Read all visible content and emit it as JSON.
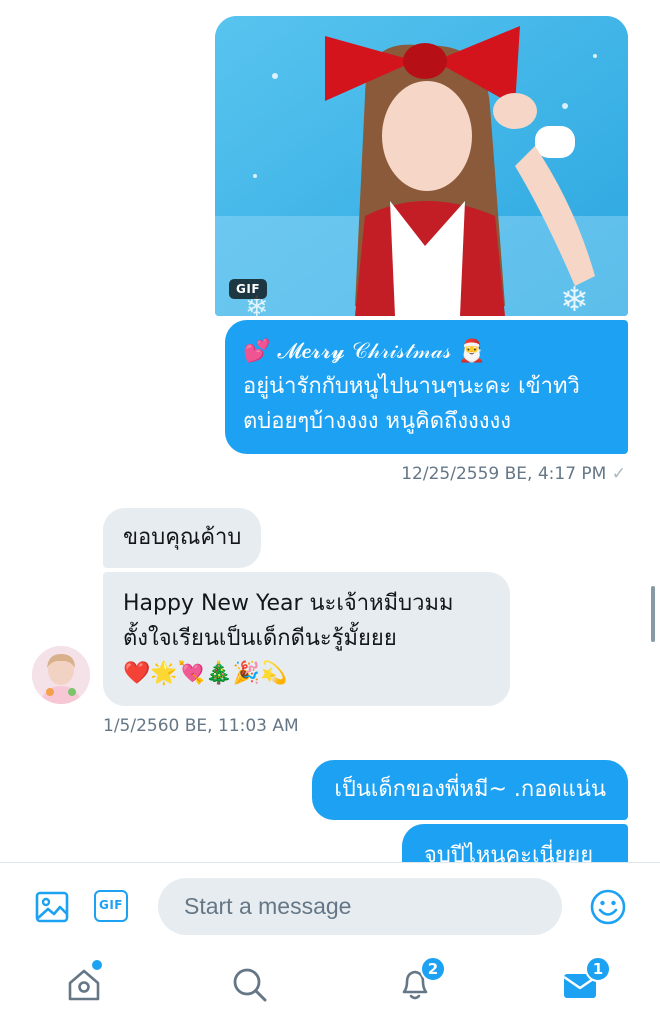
{
  "gif": {
    "badge": "GIF"
  },
  "messages": {
    "sent_1": {
      "lines": [
        "💕 𝓜𝒆𝓻𝓻𝔂 𝒞𝒽𝓇𝒾𝓈𝓉𝓂𝒶𝓈 🎅",
        "อยู่น่ารักกับหนูไปนานๆนะคะ เข้าทวิ",
        "ตบ่อยๆบ้างงงง หนูคิดถึงงงงง"
      ],
      "timestamp": "12/25/2559 BE, 4:17 PM",
      "tick": "✓"
    },
    "recv_1": {
      "text": "ขอบคุณค้าบ"
    },
    "recv_2": {
      "lines": [
        "Happy New Year นะเจ้าหมีบวมม",
        "ตั้งใจเรียนเป็นเด็กดีนะรู้มั้ยยย",
        "❤️🌟💘🎄🎉💫"
      ],
      "timestamp": "1/5/2560 BE, 11:03 AM"
    },
    "sent_2": {
      "text": "เป็นเด็กของพี่หมี~ .กอดแน่น"
    },
    "sent_3": {
      "text": "จบปีไหนคะเนี่ยยย"
    }
  },
  "composer": {
    "placeholder": "Start a message",
    "gif_label": "GIF"
  },
  "tabbar": {
    "notifications_count": "2",
    "messages_count": "1"
  },
  "colors": {
    "accent": "#1da1f2",
    "received_bubble": "#e6ecf0",
    "meta_text": "#657786"
  },
  "icons": [
    "media-icon",
    "gif-icon",
    "emoji-icon",
    "home-icon",
    "search-icon",
    "notifications-bell-icon",
    "messages-envelope-icon"
  ]
}
